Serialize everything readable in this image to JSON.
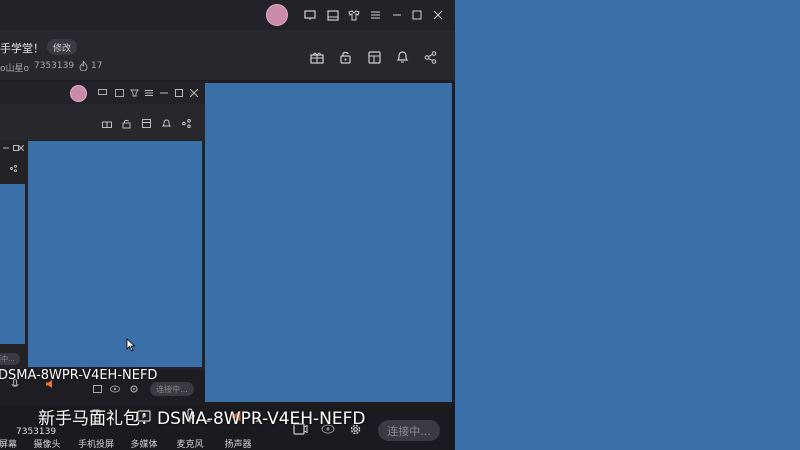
{
  "outer": {
    "stream_title": "手学堂！",
    "edit_label": "修改",
    "host_name": "o山星o",
    "room_id": "7353139",
    "heat": "17"
  },
  "mid": {
    "connect_label": "连接中...",
    "overlay_text": "DSMA-8WPR-V4EH-NEFD"
  },
  "inner": {
    "connect_label": "连接中..."
  },
  "bottom": {
    "overlay_text": "新手马面礼包：DSMA-8WPR-V4EH-NEFD",
    "room_id": "7353139",
    "connect_label": "连接中...",
    "tools": [
      {
        "label": "屏幕"
      },
      {
        "label": "摄像头"
      },
      {
        "label": "手机投屏"
      },
      {
        "label": "多媒体"
      },
      {
        "label": "麦克风"
      },
      {
        "label": "扬声器"
      }
    ]
  },
  "colors": {
    "accent_blue": "#3b6fa8",
    "panel": "#232327",
    "speaker_orange": "#e8743b"
  }
}
